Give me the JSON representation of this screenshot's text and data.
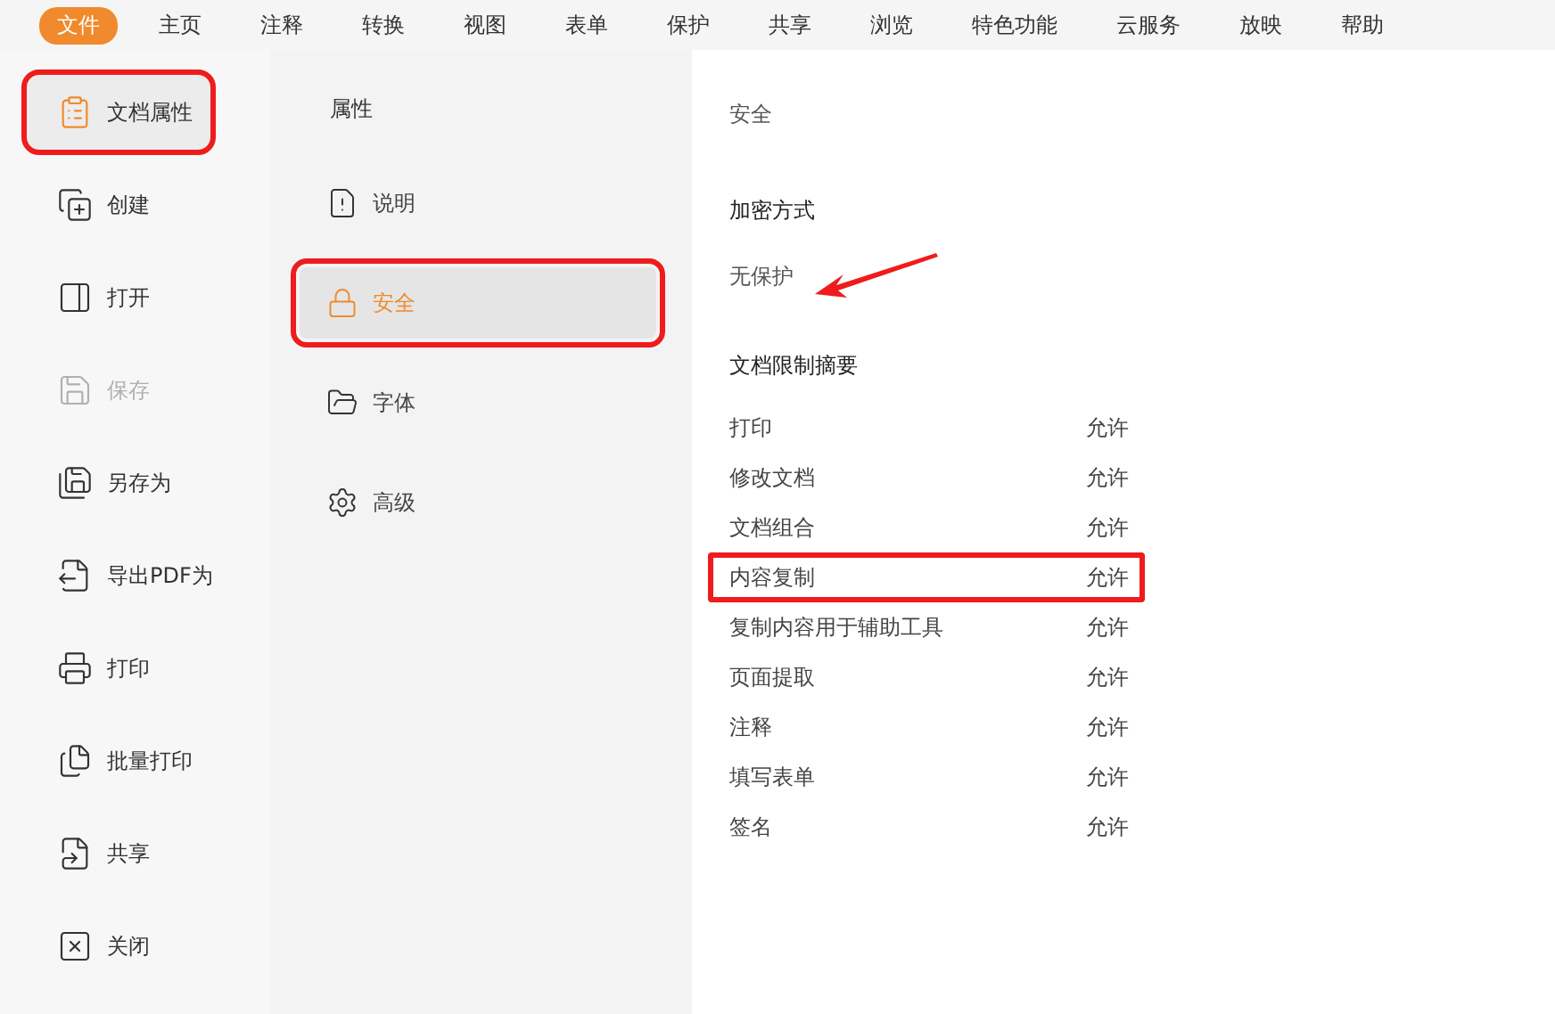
{
  "menu": [
    {
      "label": "文件",
      "selected": true
    },
    {
      "label": "主页",
      "selected": false
    },
    {
      "label": "注释",
      "selected": false
    },
    {
      "label": "转换",
      "selected": false
    },
    {
      "label": "视图",
      "selected": false
    },
    {
      "label": "表单",
      "selected": false
    },
    {
      "label": "保护",
      "selected": false
    },
    {
      "label": "共享",
      "selected": false
    },
    {
      "label": "浏览",
      "selected": false
    },
    {
      "label": "特色功能",
      "selected": false
    },
    {
      "label": "云服务",
      "selected": false
    },
    {
      "label": "放映",
      "selected": false
    },
    {
      "label": "帮助",
      "selected": false
    }
  ],
  "sidebar": {
    "items": [
      {
        "label": "文档属性",
        "selected": true,
        "disabled": false,
        "annotated": true
      },
      {
        "label": "创建",
        "selected": false,
        "disabled": false,
        "annotated": false
      },
      {
        "label": "打开",
        "selected": false,
        "disabled": false,
        "annotated": false
      },
      {
        "label": "保存",
        "selected": false,
        "disabled": true,
        "annotated": false
      },
      {
        "label": "另存为",
        "selected": false,
        "disabled": false,
        "annotated": false
      },
      {
        "label": "导出PDF为",
        "selected": false,
        "disabled": false,
        "annotated": false
      },
      {
        "label": "打印",
        "selected": false,
        "disabled": false,
        "annotated": false
      },
      {
        "label": "批量打印",
        "selected": false,
        "disabled": false,
        "annotated": false
      },
      {
        "label": "共享",
        "selected": false,
        "disabled": false,
        "annotated": false
      },
      {
        "label": "关闭",
        "selected": false,
        "disabled": false,
        "annotated": false
      }
    ]
  },
  "properties": {
    "title": "属性",
    "items": [
      {
        "label": "说明",
        "selected": false,
        "annotated": false
      },
      {
        "label": "安全",
        "selected": true,
        "annotated": true
      },
      {
        "label": "字体",
        "selected": false,
        "annotated": false
      },
      {
        "label": "高级",
        "selected": false,
        "annotated": false
      }
    ]
  },
  "security": {
    "title": "安全",
    "encryption": {
      "heading": "加密方式",
      "value": "无保护",
      "arrow_annotation": true
    },
    "restrictions": {
      "heading": "文档限制摘要",
      "rows": [
        {
          "label": "打印",
          "value": "允许",
          "annotated": false
        },
        {
          "label": "修改文档",
          "value": "允许",
          "annotated": false
        },
        {
          "label": "文档组合",
          "value": "允许",
          "annotated": false
        },
        {
          "label": "内容复制",
          "value": "允许",
          "annotated": true
        },
        {
          "label": "复制内容用于辅助工具",
          "value": "允许",
          "annotated": false
        },
        {
          "label": "页面提取",
          "value": "允许",
          "annotated": false
        },
        {
          "label": "注释",
          "value": "允许",
          "annotated": false
        },
        {
          "label": "填写表单",
          "value": "允许",
          "annotated": false
        },
        {
          "label": "签名",
          "value": "允许",
          "annotated": false
        }
      ]
    }
  }
}
